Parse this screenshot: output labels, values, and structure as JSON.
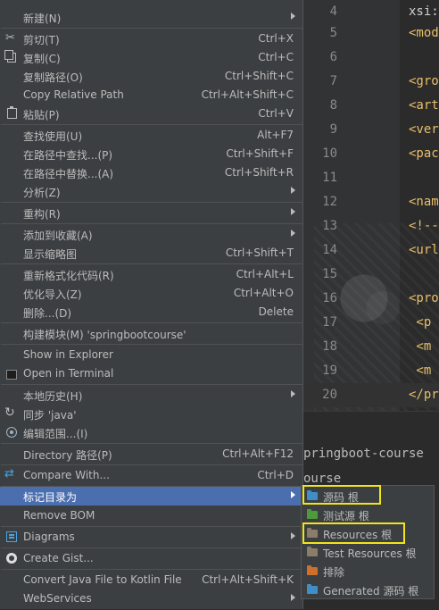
{
  "editor": {
    "lines": [
      {
        "num": "4",
        "code": "xsi:"
      },
      {
        "num": "5",
        "code": "<mod"
      },
      {
        "num": "6",
        "code": ""
      },
      {
        "num": "7",
        "code": "<gro"
      },
      {
        "num": "8",
        "code": "<art"
      },
      {
        "num": "9",
        "code": "<ver"
      },
      {
        "num": "10",
        "code": "<pac"
      },
      {
        "num": "11",
        "code": ""
      },
      {
        "num": "12",
        "code": "<nam"
      },
      {
        "num": "13",
        "code": "<!--"
      },
      {
        "num": "14",
        "code": "<url"
      },
      {
        "num": "15",
        "code": ""
      },
      {
        "num": "16",
        "code": "<pro"
      },
      {
        "num": "17",
        "code": " <p"
      },
      {
        "num": "18",
        "code": " <m"
      },
      {
        "num": "19",
        "code": " <m"
      },
      {
        "num": "20",
        "code": "</pr"
      }
    ],
    "console": {
      "line1": "pringboot-course",
      "line2": "ourse"
    }
  },
  "menu": {
    "new": {
      "label": "新建(N)"
    },
    "cut": {
      "label": "剪切(T)",
      "shortcut": "Ctrl+X"
    },
    "copy": {
      "label": "复制(C)",
      "shortcut": "Ctrl+C"
    },
    "copy_path": {
      "label": "复制路径(O)",
      "shortcut": "Ctrl+Shift+C"
    },
    "copy_relative_path": {
      "label": "Copy Relative Path",
      "shortcut": "Ctrl+Alt+Shift+C"
    },
    "paste": {
      "label": "粘贴(P)",
      "shortcut": "Ctrl+V"
    },
    "find_usages": {
      "label": "查找使用(U)",
      "shortcut": "Alt+F7"
    },
    "find_in_path": {
      "label": "在路径中查找...(P)",
      "shortcut": "Ctrl+Shift+F"
    },
    "replace_in_path": {
      "label": "在路径中替换...(A)",
      "shortcut": "Ctrl+Shift+R"
    },
    "analyze": {
      "label": "分析(Z)"
    },
    "refactor": {
      "label": "重构(R)"
    },
    "add_to_favorites": {
      "label": "添加到收藏(A)"
    },
    "show_thumbnails": {
      "label": "显示缩略图",
      "shortcut": "Ctrl+Shift+T"
    },
    "reformat_code": {
      "label": "重新格式化代码(R)",
      "shortcut": "Ctrl+Alt+L"
    },
    "optimize_imports": {
      "label": "优化导入(Z)",
      "shortcut": "Ctrl+Alt+O"
    },
    "delete": {
      "label": "删除...(D)",
      "shortcut": "Delete"
    },
    "build_module": {
      "label": "构建模块(M) 'springbootcourse'"
    },
    "show_in_explorer": {
      "label": "Show in Explorer"
    },
    "open_in_terminal": {
      "label": "Open in Terminal"
    },
    "local_history": {
      "label": "本地历史(H)"
    },
    "sync": {
      "label": "同步 'java'"
    },
    "edit_scopes": {
      "label": "编辑范围...(I)"
    },
    "directory_path": {
      "label": "Directory 路径(P)",
      "shortcut": "Ctrl+Alt+F12"
    },
    "compare_with": {
      "label": "Compare With...",
      "shortcut": "Ctrl+D"
    },
    "mark_directory_as": {
      "label": "标记目录为"
    },
    "remove_bom": {
      "label": "Remove BOM"
    },
    "diagrams": {
      "label": "Diagrams"
    },
    "create_gist": {
      "label": "Create Gist..."
    },
    "convert_java_to_kotlin": {
      "label": "Convert Java File to Kotlin File",
      "shortcut": "Ctrl+Alt+Shift+K"
    },
    "webservices": {
      "label": "WebServices"
    }
  },
  "submenu": {
    "sources_root": {
      "label": "源码 根",
      "color": "#3f8fc6"
    },
    "test_sources_root": {
      "label": "测试源 根",
      "color": "#4f9a3c"
    },
    "resources_root": {
      "label": "Resources 根",
      "color": "#8c7d6b"
    },
    "test_resources_root": {
      "label": "Test Resources 根",
      "color": "#8c7d6b"
    },
    "excluded": {
      "label": "排除",
      "color": "#cf6f2e"
    },
    "generated_sources_root": {
      "label": "Generated 源码 根",
      "color": "#3f8fc6"
    }
  },
  "colors": {
    "menu_bg": "#3c3f41",
    "selection": "#4b6eaf",
    "highlight_box": "#f1e51a"
  }
}
